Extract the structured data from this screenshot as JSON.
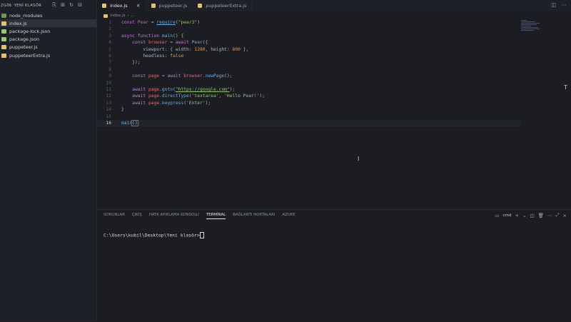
{
  "explorer": {
    "title": "ZGİN: YENİ KLASÖR",
    "items": [
      {
        "label": "node_modules",
        "color": "#6a9955"
      },
      {
        "label": "index.js",
        "color": "#e5c07b"
      },
      {
        "label": "package-lock.json",
        "color": "#98c379"
      },
      {
        "label": "package.json",
        "color": "#98c379"
      },
      {
        "label": "puppeteer.js",
        "color": "#e5c07b"
      },
      {
        "label": "puppeteerExtra.js",
        "color": "#e5c07b"
      }
    ]
  },
  "tabs": [
    {
      "label": "index.js",
      "close": "×"
    },
    {
      "label": "puppeteer.js"
    },
    {
      "label": "puppeteerExtra.js"
    }
  ],
  "breadcrumb": {
    "file": "index.js",
    "sep": "› ..."
  },
  "editor": {
    "lines": [
      {
        "n": "1"
      },
      {
        "n": "2"
      },
      {
        "n": "3"
      },
      {
        "n": "4"
      },
      {
        "n": "5"
      },
      {
        "n": "6"
      },
      {
        "n": "7"
      },
      {
        "n": "8"
      },
      {
        "n": "9"
      },
      {
        "n": "10"
      },
      {
        "n": "11"
      },
      {
        "n": "12"
      },
      {
        "n": "13"
      },
      {
        "n": "14"
      },
      {
        "n": "15"
      },
      {
        "n": "16"
      }
    ],
    "code": {
      "l1_kw": "const",
      "l1_var": "Pear",
      "l1_eq": "=",
      "l1_fn": "require",
      "l1_str": "\"pear3\"",
      "l3_kw1": "async",
      "l3_kw2": "function",
      "l3_fn": "main",
      "l4_kw": "const",
      "l4_var": "browser",
      "l4_aw": "await",
      "l4_fn": "Pear",
      "l5_prop": "viewport",
      "l5_w": "width",
      "l5_wv": "1280",
      "l5_h": "height",
      "l5_hv": "800",
      "l6_prop": "headless",
      "l6_val": "false",
      "l9_kw": "const",
      "l9_var": "page",
      "l9_aw": "await",
      "l9_obj": "browser",
      "l9_fn": "newPage",
      "l11_aw": "await",
      "l11_obj": "page",
      "l11_fn": "goto",
      "l11_str": "\"https://google.com\"",
      "l12_aw": "await",
      "l12_obj": "page",
      "l12_fn": "directType",
      "l12_s1": "'textarea'",
      "l12_s2": "'Hello Pear!'",
      "l13_aw": "await",
      "l13_obj": "page",
      "l13_fn": "keypress",
      "l13_s": "'Enter'",
      "l16_fn": "main"
    }
  },
  "panel": {
    "tabs": [
      "SORUNLAR",
      "ÇIKIŞ",
      "HATA AYIKLAMA KONSOLU",
      "TERMİNAL",
      "BAĞLANTI NOKTALARI",
      "AZURE"
    ],
    "active": "TERMİNAL",
    "shell": "cmd",
    "prompt": "C:\\Users\\kubil\\Desktop\\Yeni klasör>"
  }
}
